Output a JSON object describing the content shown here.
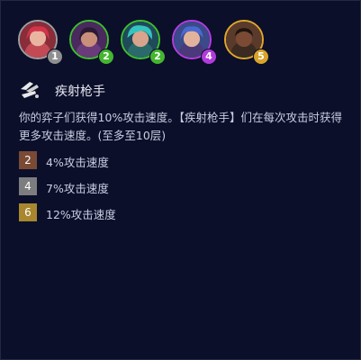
{
  "champions": [
    {
      "cost": "1",
      "border_color": "#9e9e9e",
      "badge_color": "#8f8f8f",
      "portrait": "champion-portrait-1"
    },
    {
      "cost": "2",
      "border_color": "#3fbf2f",
      "badge_color": "#44b630",
      "portrait": "champion-portrait-2"
    },
    {
      "cost": "2",
      "border_color": "#3fbf2f",
      "badge_color": "#44b630",
      "portrait": "champion-portrait-3"
    },
    {
      "cost": "4",
      "border_color": "#b53de0",
      "badge_color": "#b23bdb",
      "portrait": "champion-portrait-4"
    },
    {
      "cost": "5",
      "border_color": "#e0a82a",
      "badge_color": "#d9a429",
      "portrait": "champion-portrait-5"
    }
  ],
  "trait": {
    "icon": "rapidfire-trait-icon",
    "name": "疾射枪手",
    "description": "你的弈子们获得10%攻击速度。【疾射枪手】们在每次攻击时获得更多攻击速度。(至多至10层)"
  },
  "tiers": [
    {
      "count": "2",
      "color": "#7a4a35",
      "text": "4%攻击速度"
    },
    {
      "count": "4",
      "color": "#7d7d80",
      "text": "7%攻击速度"
    },
    {
      "count": "6",
      "color": "#a8872e",
      "text": "12%攻击速度"
    }
  ],
  "colors": {
    "background": "#0b0f2a",
    "text": "#c9cce0",
    "title": "#e6e8f2"
  }
}
